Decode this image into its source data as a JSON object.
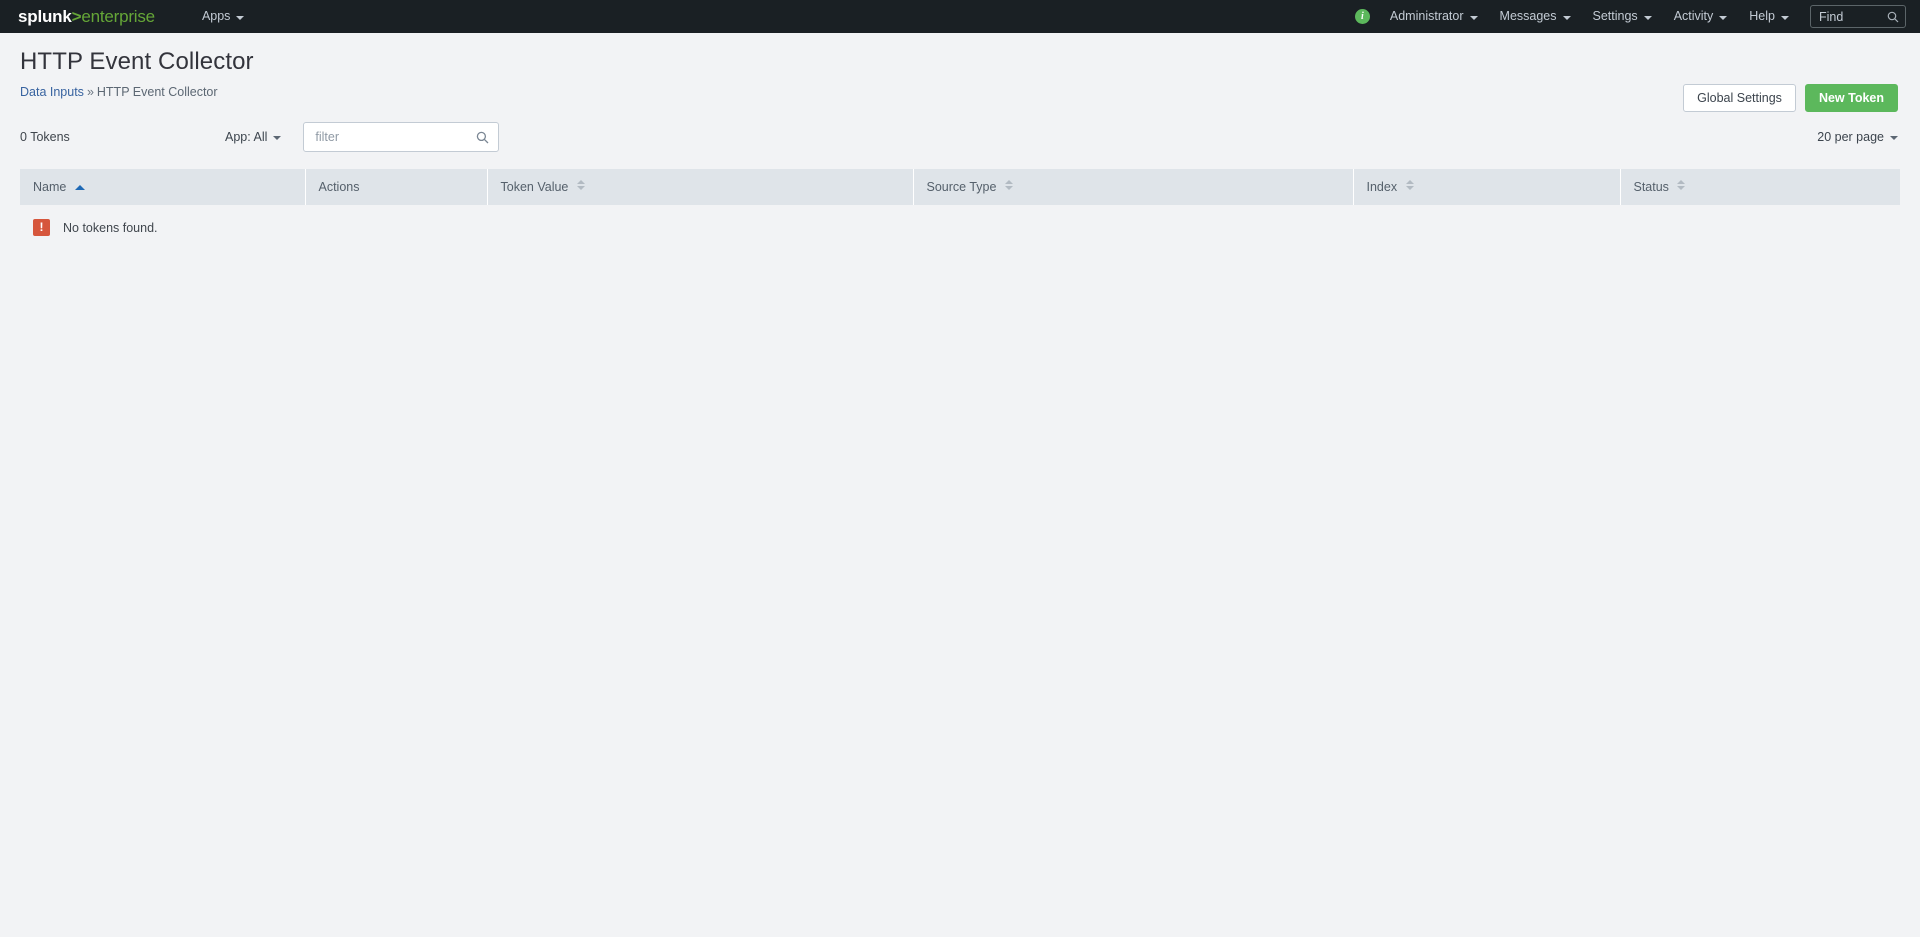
{
  "nav": {
    "brand": {
      "splunk": "splunk",
      "gt": ">",
      "enterprise": "enterprise"
    },
    "left_items": [
      {
        "label": "Apps",
        "caret": true
      }
    ],
    "info_badge": "i",
    "right_items": [
      {
        "label": "Administrator",
        "caret": true
      },
      {
        "label": "Messages",
        "caret": true
      },
      {
        "label": "Settings",
        "caret": true
      },
      {
        "label": "Activity",
        "caret": true
      },
      {
        "label": "Help",
        "caret": true
      }
    ],
    "find": {
      "label": "Find",
      "icon": "search-icon"
    }
  },
  "header": {
    "title": "HTTP Event Collector",
    "breadcrumb": {
      "link": "Data Inputs",
      "separator": "»",
      "current": "HTTP Event Collector"
    },
    "global_settings_label": "Global Settings",
    "new_token_label": "New Token"
  },
  "controls": {
    "token_count": "0 Tokens",
    "app_filter_label": "App: All",
    "filter_placeholder": "filter",
    "filter_value": "",
    "per_page_label": "20 per page"
  },
  "table": {
    "columns": [
      {
        "label": "Name",
        "sortable": true,
        "sorted": "asc"
      },
      {
        "label": "Actions",
        "sortable": false,
        "sorted": "none"
      },
      {
        "label": "Token Value",
        "sortable": true,
        "sorted": "none"
      },
      {
        "label": "Source Type",
        "sortable": true,
        "sorted": "none"
      },
      {
        "label": "Index",
        "sortable": true,
        "sorted": "none"
      },
      {
        "label": "Status",
        "sortable": true,
        "sorted": "none"
      }
    ],
    "rows": [],
    "empty_message": "No tokens found.",
    "empty_icon": "!"
  },
  "colors": {
    "nav_background": "#1a2024",
    "brand_green": "#65a637",
    "primary_green": "#5cb85c",
    "page_background": "#f2f3f5",
    "table_header": "#dfe4e9",
    "error_red": "#d6563c",
    "link_blue": "#3863a0",
    "sort_active_blue": "#1e69b5"
  }
}
